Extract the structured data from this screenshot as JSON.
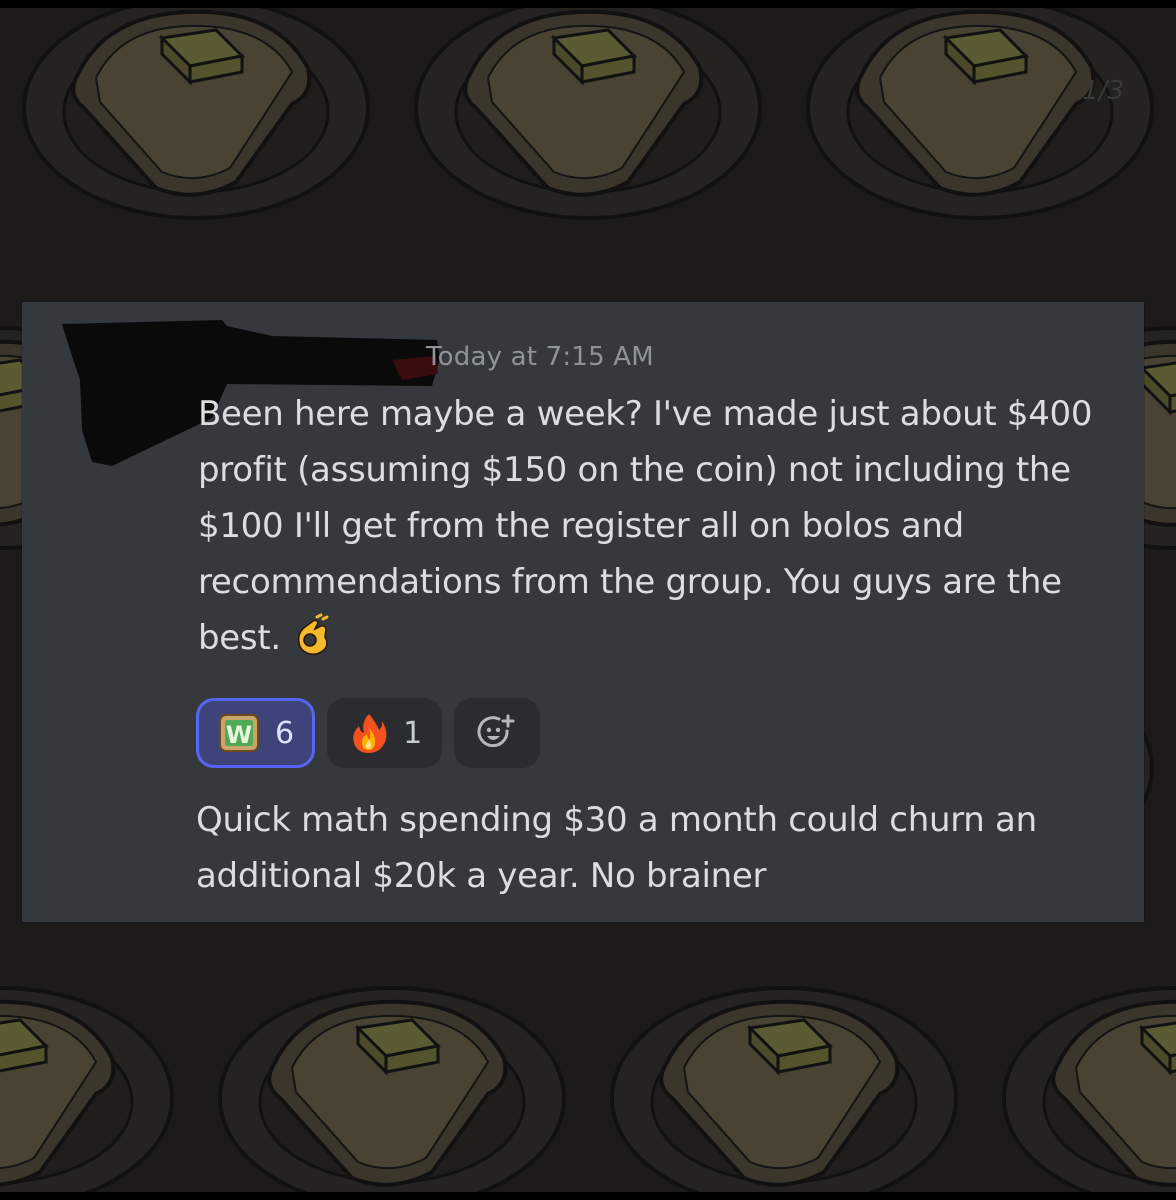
{
  "background": {
    "pattern_icon": "toast-with-butter-icon",
    "page_counter": "1/3"
  },
  "message": {
    "author_redacted": true,
    "timestamp": "Today at 7:15 AM",
    "text": "Been here maybe a week? I've made just about $400 profit (assuming $150 on the coin) not including the $100 I'll get from the register all on bolos and recommendations from the group. You guys are the best.",
    "text_emoji": "ok-hand-emoji",
    "reactions": [
      {
        "emoji": "w-toast-emoji",
        "count": "6",
        "active": true
      },
      {
        "emoji": "fire-emoji",
        "count": "1",
        "active": false
      }
    ],
    "add_reaction_icon": "add-reaction-icon",
    "followup_text": "Quick math spending $30 a month could churn an additional $20k a year. No brainer"
  },
  "colors": {
    "card_background": "#35383d",
    "message_text": "#dcdde0",
    "timestamp_text": "#8f949b",
    "active_reaction_border": "#5865f2",
    "active_reaction_fill": "#3e447a"
  }
}
